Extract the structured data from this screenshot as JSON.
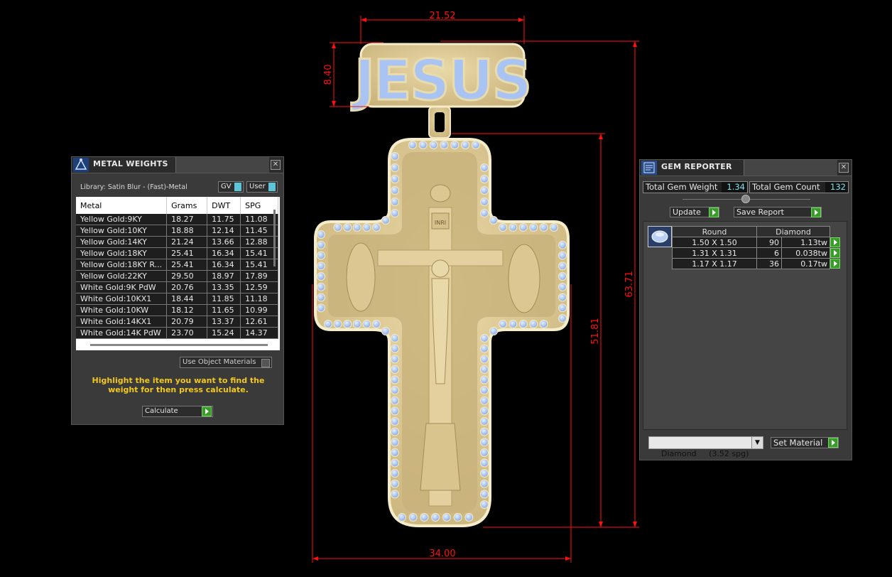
{
  "metal_weights": {
    "title": "METAL WEIGHTS",
    "library": "Library: Satin Blur - (Fast)-Metal",
    "gv_label": "GV",
    "user_label": "User",
    "columns": [
      "Metal",
      "Grams",
      "DWT",
      "SPG"
    ],
    "rows": [
      [
        "Yellow Gold:9KY",
        "18.27",
        "11.75",
        "11.08"
      ],
      [
        "Yellow Gold:10KY",
        "18.88",
        "12.14",
        "11.45"
      ],
      [
        "Yellow Gold:14KY",
        "21.24",
        "13.66",
        "12.88"
      ],
      [
        "Yellow Gold:18KY",
        "25.41",
        "16.34",
        "15.41"
      ],
      [
        "Yellow Gold:18KY R...",
        "25.41",
        "16.34",
        "15.41"
      ],
      [
        "Yellow Gold:22KY",
        "29.50",
        "18.97",
        "17.89"
      ],
      [
        "White Gold:9K PdW",
        "20.76",
        "13.35",
        "12.59"
      ],
      [
        "White Gold:10KX1",
        "18.44",
        "11.85",
        "11.18"
      ],
      [
        "White Gold:10KW",
        "18.12",
        "11.65",
        "10.99"
      ],
      [
        "White Gold:14KX1",
        "20.79",
        "13.37",
        "12.61"
      ],
      [
        "White Gold:14K PdW",
        "23.70",
        "15.24",
        "14.37"
      ]
    ],
    "use_object_materials": "Use Object Materials",
    "hint": "Highlight the item you want to find the weight for then press calculate.",
    "calculate_label": "Calculate"
  },
  "gem_reporter": {
    "title": "GEM REPORTER",
    "total_weight_label": "Total Gem Weight",
    "total_weight_value": "1.34",
    "total_count_label": "Total Gem Count",
    "total_count_value": "132",
    "update_label": "Update",
    "save_report_label": "Save Report",
    "header_shape": "Round",
    "header_material": "Diamond",
    "rows": [
      [
        "1.50 X 1.50",
        "90",
        "1.13tw"
      ],
      [
        "1.31 X 1.31",
        "6",
        "0.038tw"
      ],
      [
        "1.17 X 1.17",
        "36",
        "0.17tw"
      ]
    ],
    "material_select": "Diamond     (3.52 spg)",
    "set_material_label": "Set Material"
  },
  "drawing": {
    "pendant_text": "JESUS",
    "plaque_text": "INRI",
    "dimensions": {
      "top_width": "21.52",
      "top_height": "8.40",
      "cross_height": "51.81",
      "total_height": "63.71",
      "cross_width": "34.00"
    }
  },
  "colors": {
    "background": "#000000",
    "dimension_line": "#ff1010",
    "gold": "#d9c58f",
    "gem": "#a9c4f2",
    "button_green": "#3a9a2a",
    "hint_text": "#f2c81e",
    "value_text": "#7fe0ee"
  }
}
